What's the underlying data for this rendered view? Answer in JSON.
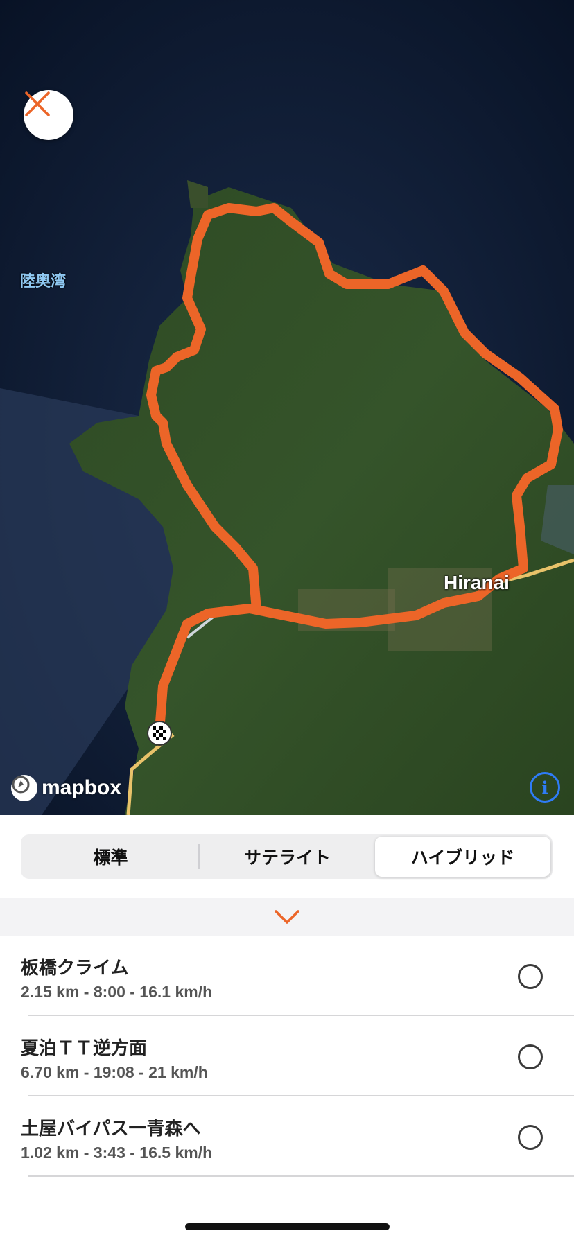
{
  "map": {
    "water_label": "陸奥湾",
    "city_label": "Hiranai",
    "attribution_logo_text": "mapbox",
    "route_color": "#ec6528",
    "info_icon_glyph": "i"
  },
  "map_type_control": {
    "options": [
      "標準",
      "サテライト",
      "ハイブリッド"
    ],
    "selected": "ハイブリッド"
  },
  "segments": [
    {
      "name": "板橋クライム",
      "stats": "2.15 km - 8:00 - 16.1 km/h",
      "checked": false
    },
    {
      "name": "夏泊ＴＴ逆方面",
      "stats": "6.70 km - 19:08 - 21 km/h",
      "checked": false
    },
    {
      "name": "土屋バイパス一青森へ",
      "stats": "1.02 km - 3:43 - 16.5 km/h",
      "checked": false
    }
  ],
  "icons": {
    "close": "close-icon",
    "collapse": "chevron-down-icon",
    "finish": "checkered-flag-icon",
    "info": "info-icon"
  },
  "colors": {
    "accent": "#ec6528",
    "info_blue": "#2f7cf6"
  }
}
